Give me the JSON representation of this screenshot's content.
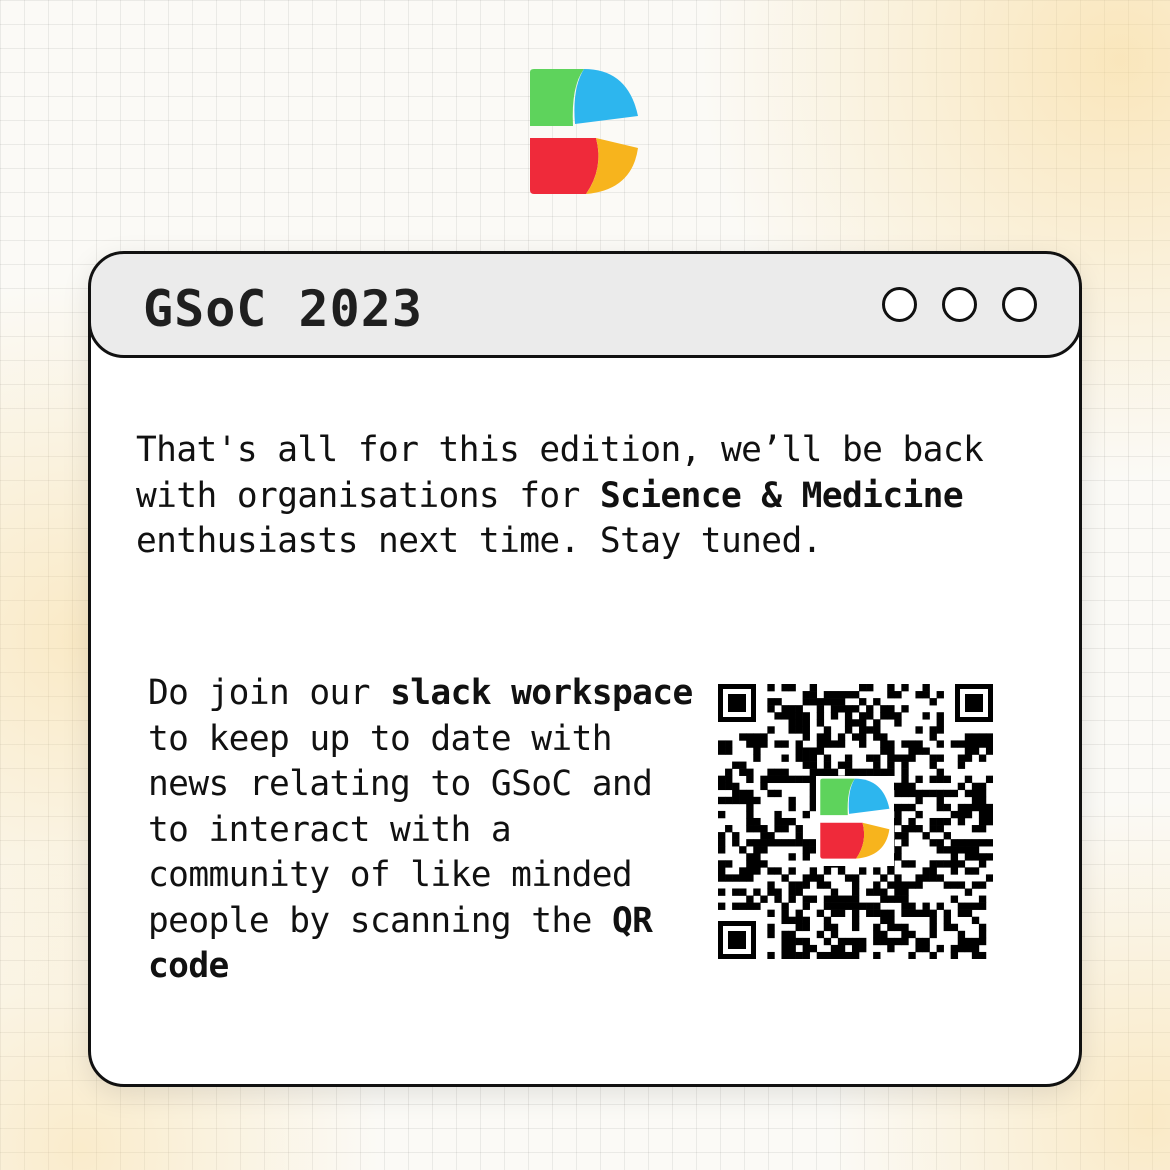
{
  "header": {
    "logo_icon": "colorful-s-logo-icon"
  },
  "window": {
    "title": "GSoC 2023",
    "controls": [
      "circle-button",
      "circle-button",
      "circle-button"
    ]
  },
  "message": {
    "p1_a": "That's all for this edition, we’ll be back with organisations for ",
    "p1_b": "Science & Medicine",
    "p1_c": " enthusiasts next time. Stay tuned.",
    "p2_a": "Do join our ",
    "p2_b": "slack workspace",
    "p2_c": " to keep up to date with news relating to GSoC and to interact with a community of like minded people by scanning the ",
    "p2_d": "QR code"
  },
  "qr": {
    "icon": "qr-code-icon",
    "center_logo": "colorful-s-logo-icon"
  },
  "colors": {
    "logo_green": "#5ed35c",
    "logo_blue": "#2db6ee",
    "logo_red": "#ef2a3a",
    "logo_yellow": "#f7b41d",
    "border": "#111111",
    "titlebar": "#ebebeb"
  }
}
